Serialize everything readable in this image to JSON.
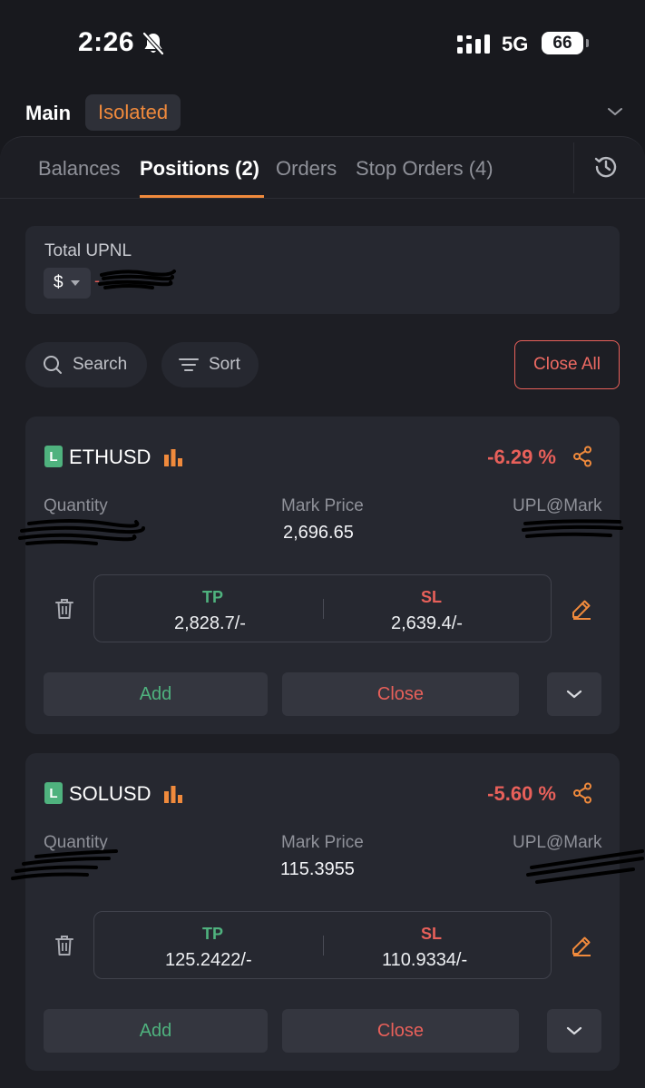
{
  "status_bar": {
    "time": "2:26",
    "network": "5G",
    "battery": "66",
    "icons": [
      "bell-slash-icon",
      "signal-bars-icon",
      "battery-icon"
    ]
  },
  "account": {
    "name": "Main",
    "mode": "Isolated",
    "icons": [
      "chevron-down-icon"
    ]
  },
  "tabs": [
    {
      "label": "Balances",
      "active": false
    },
    {
      "label": "Positions (2)",
      "active": true
    },
    {
      "label": "Orders",
      "active": false
    },
    {
      "label": "Stop Orders (4)",
      "active": false
    }
  ],
  "summary": {
    "label": "Total UPNL",
    "currency": "$",
    "value": "-"
  },
  "toolbar": {
    "search_label": "Search",
    "sort_label": "Sort",
    "close_all_label": "Close All"
  },
  "positions": [
    {
      "side_badge": "L",
      "symbol": "ETHUSD",
      "pnl_percent": "-6.29 %",
      "quantity_label": "Quantity",
      "mark_price_label": "Mark Price",
      "mark_price": "2,696.65",
      "upl_label": "UPL@Mark",
      "tp_label": "TP",
      "tp_value": "2,828.7/-",
      "sl_label": "SL",
      "sl_value": "2,639.4/-",
      "add_label": "Add",
      "close_label": "Close"
    },
    {
      "side_badge": "L",
      "symbol": "SOLUSD",
      "pnl_percent": "-5.60 %",
      "quantity_label": "Quantity",
      "mark_price_label": "Mark Price",
      "mark_price": "115.3955",
      "upl_label": "UPL@Mark",
      "tp_label": "TP",
      "tp_value": "125.2422/-",
      "sl_label": "SL",
      "sl_value": "110.9334/-",
      "add_label": "Add",
      "close_label": "Close"
    }
  ],
  "colors": {
    "background": "#18191e",
    "card": "#262830",
    "accent": "#f08a3c",
    "long": "#4fb27e",
    "loss": "#e8605a"
  }
}
